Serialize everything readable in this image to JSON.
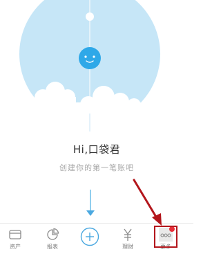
{
  "main": {
    "greeting": "Hi,口袋君",
    "subtitle": "创建你的第一笔账吧"
  },
  "tabbar": {
    "items": [
      {
        "label": "资产",
        "icon": "wallet-icon"
      },
      {
        "label": "报表",
        "icon": "pie-chart-icon"
      },
      {
        "label": "",
        "icon": "add-icon"
      },
      {
        "label": "理财",
        "icon": "yen-icon"
      },
      {
        "label": "更多",
        "icon": "more-dots-icon"
      }
    ]
  },
  "colors": {
    "sky": "#c6e6f7",
    "face": "#2ea8e8",
    "accent": "#4aa8e0",
    "annotation": "#b3161c",
    "badge": "#e8303a"
  }
}
